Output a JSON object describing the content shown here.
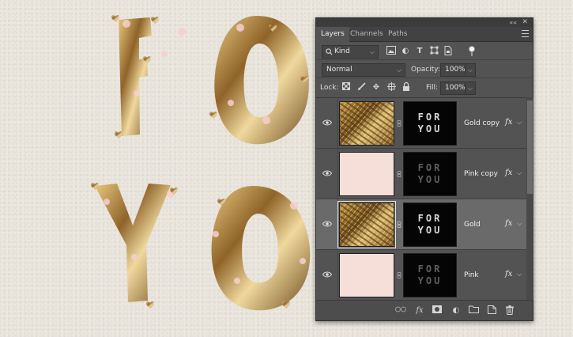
{
  "tabs": [
    {
      "label": "Layers",
      "active": true
    },
    {
      "label": "Channels",
      "active": false
    },
    {
      "label": "Paths",
      "active": false
    }
  ],
  "filter": {
    "kind_value": "Kind"
  },
  "blend": {
    "mode": "Normal",
    "opacity_label": "Opacity:",
    "opacity_value": "100%"
  },
  "lock": {
    "label": "Lock:",
    "fill_label": "Fill:",
    "fill_value": "100%"
  },
  "layers": [
    {
      "name": "Gold copy",
      "thumb": "gold",
      "mask_lines": [
        "FOR",
        "YOU"
      ],
      "visible": true,
      "selected": false,
      "fx": "fx"
    },
    {
      "name": "Pink copy",
      "thumb": "pink",
      "mask_lines": [
        "FOR",
        "YOU"
      ],
      "visible": true,
      "selected": false,
      "fx": "fx"
    },
    {
      "name": "Gold",
      "thumb": "gold",
      "mask_lines": [
        "FOR",
        "YOU"
      ],
      "visible": true,
      "selected": true,
      "fx": "fx"
    },
    {
      "name": "Pink",
      "thumb": "pink",
      "mask_lines": [
        "FOR",
        "YOU"
      ],
      "visible": true,
      "selected": false,
      "fx": "fx"
    }
  ],
  "colors": {
    "gold": "#b88d3d",
    "pink": "#f6dfd8",
    "panel": "#535353"
  }
}
